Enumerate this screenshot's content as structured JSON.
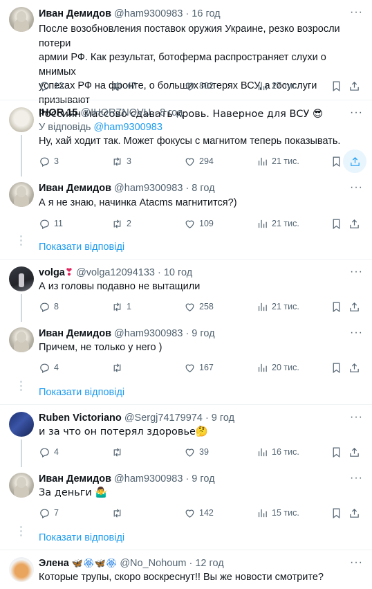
{
  "ui": {
    "show_replies": "Показати відповіді",
    "reply_prefix": "У відповідь",
    "more": "···"
  },
  "tweets": [
    {
      "name": "Иван Демидов",
      "handle": "@ham9300983",
      "time": "· 16 год",
      "text_lines": [
        "После возобновления поставок оружия Украине, резко возросли потери",
        "армии РФ. Как результат, ботоферма распространяет слухи о мнимых",
        "успехах РФ на фронте, о больших потерях ВСУ, а госуслуги призывают",
        "Россиян массово сдавать кровь. Наверное для ВСУ 😎"
      ],
      "replies": "12",
      "retweets": "47",
      "likes": "802",
      "views": "27 тис.",
      "avatar": "bust-avatar"
    },
    {
      "name": "IHOR 15",
      "handle": "@IHORZNOVU",
      "time": "· 8 год",
      "reply_to": "@ham9300983",
      "text_lines": [
        "Ну, хай ходит так. Может фокусы с магнитом теперь показывать."
      ],
      "replies": "3",
      "retweets": "3",
      "likes": "294",
      "views": "21 тис.",
      "avatar": "cat-avatar"
    },
    {
      "name": "Иван Демидов",
      "handle": "@ham9300983",
      "time": "· 8 год",
      "text_lines": [
        "А я не знаю, начинка Atacms магнитится?)"
      ],
      "replies": "11",
      "retweets": "2",
      "likes": "109",
      "views": "21 тис.",
      "avatar": "bust-avatar"
    },
    {
      "name": "volga",
      "badge": "❣",
      "handle": "@volga12094133",
      "time": "· 10 год",
      "text_lines": [
        "А из головы подавно не вытащили"
      ],
      "replies": "8",
      "retweets": "1",
      "likes": "258",
      "views": "21 тис.",
      "avatar": "dark-avatar"
    },
    {
      "name": "Иван Демидов",
      "handle": "@ham9300983",
      "time": "· 9 год",
      "text_lines": [
        "Причем, не только у него )"
      ],
      "replies": "4",
      "retweets": "",
      "likes": "167",
      "views": "20 тис.",
      "avatar": "bust-avatar"
    },
    {
      "name": "Ruben Victoriano",
      "handle": "@Sergj74179974",
      "time": "· 9 год",
      "text_lines": [
        "и за что он потерял здоровье🤔"
      ],
      "replies": "4",
      "retweets": "",
      "likes": "39",
      "views": "16 тис.",
      "avatar": "blue-avatar"
    },
    {
      "name": "Иван Демидов",
      "handle": "@ham9300983",
      "time": "· 9 год",
      "text_lines": [
        "За деньги 🤷‍♂️"
      ],
      "replies": "7",
      "retweets": "",
      "likes": "142",
      "views": "15 тис.",
      "avatar": "bust-avatar"
    },
    {
      "name": "Элена",
      "badge": "🦋🏵🦋🏵",
      "handle": "@No_Nohoum",
      "time": "· 12 год",
      "text_lines": [
        "Которые трупы, скоро воскреснут!! Вы же новости смотрите?"
      ],
      "avatar": "orange-avatar"
    }
  ]
}
